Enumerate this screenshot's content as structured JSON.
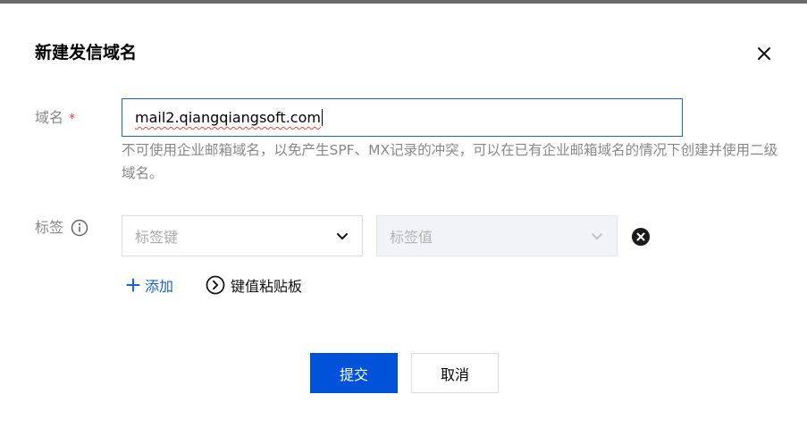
{
  "dialog": {
    "title": "新建发信域名",
    "close_icon": "close-icon"
  },
  "domain": {
    "label": "域名",
    "required_mark": "*",
    "value": "mail2.qiangqiangsoft.com",
    "help": "不可使用企业邮箱域名，以免产生SPF、MX记录的冲突，可以在已有企业邮箱域名的情况下创建并使用二级域名。"
  },
  "tags": {
    "label": "标签",
    "info_icon": "info-icon",
    "key_placeholder": "标签键",
    "value_placeholder": "标签值",
    "remove_icon": "remove-circle-icon",
    "add_label": "添加",
    "clipboard_label": "键值粘贴板"
  },
  "actions": {
    "submit_label": "提交",
    "cancel_label": "取消"
  },
  "colors": {
    "primary": "#0052d9",
    "link": "#1f5fd1",
    "required": "#e54545",
    "muted_text": "#888888"
  }
}
